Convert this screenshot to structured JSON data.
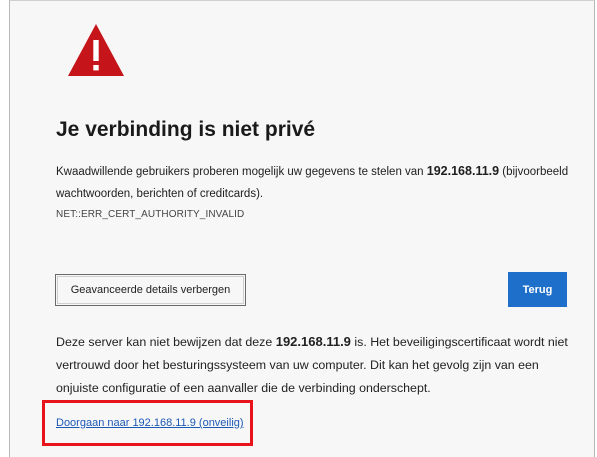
{
  "page": {
    "title": "Je verbinding is niet privé",
    "intro": {
      "before": "Kwaadwillende gebruikers proberen mogelijk uw gegevens te stelen van ",
      "host": "192.168.11.9",
      "after": " (bijvoorbeeld wachtwoorden, berichten of creditcards)."
    },
    "error_code": "NET::ERR_CERT_AUTHORITY_INVALID"
  },
  "buttons": {
    "advanced_label": "Geavanceerde details verbergen",
    "back_label": "Terug"
  },
  "details": {
    "before": "Deze server kan niet bewijzen dat deze ",
    "host": "192.168.11.9",
    "after": " is. Het beveiligingscertificaat wordt niet vertrouwd door het besturingssysteem van uw computer. Dit kan het gevolg zijn van een onjuiste configuratie of een aanvaller die de verbinding onderschept."
  },
  "proceed_link": "Doorgaan naar 192.168.11.9 (onveilig)",
  "icons": {
    "warning": "warning-triangle-icon"
  },
  "colors": {
    "warning_red": "#c5151a",
    "primary_blue": "#1d6fc9",
    "link_blue": "#1d58b5",
    "highlight_red": "#e8141b",
    "page_background": "#f7f7f7"
  }
}
